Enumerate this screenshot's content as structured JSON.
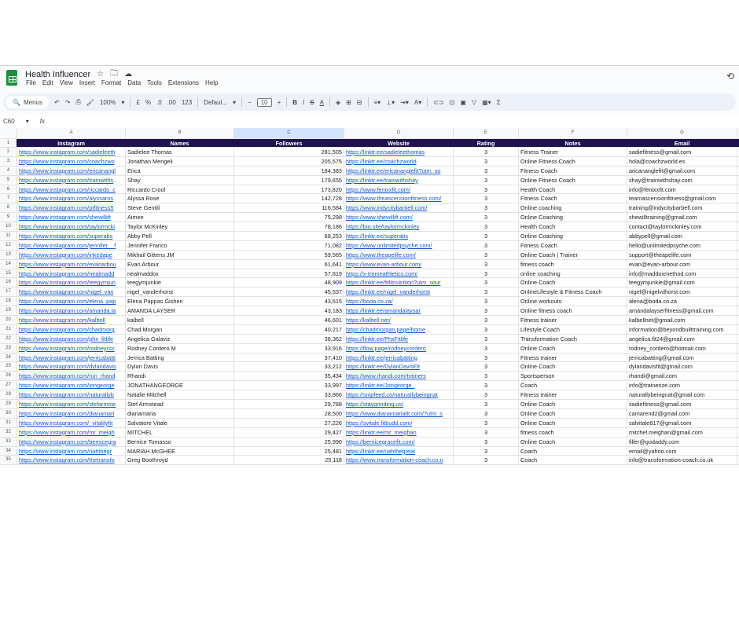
{
  "app": {
    "title": "Health Influencer",
    "menu": [
      "File",
      "Edit",
      "View",
      "Insert",
      "Format",
      "Data",
      "Tools",
      "Extensions",
      "Help"
    ]
  },
  "toolbar": {
    "search": "Menus",
    "zoom": "100%",
    "currency": "£",
    "percent": "%",
    "dec_less": ".0",
    "dec_more": ".00",
    "format_num": "123",
    "font": "Defaul...",
    "font_size": "10",
    "bold": "B",
    "italic": "I",
    "strike": "S",
    "text_color": "A",
    "sum": "Σ"
  },
  "formula_bar": {
    "cell_ref": "C60",
    "fx": "fx"
  },
  "columns": [
    "A",
    "B",
    "C",
    "D",
    "E",
    "F",
    "G"
  ],
  "headers": [
    "Instagram",
    "Names",
    "Followers",
    "Website",
    "Rating",
    "Notes",
    "Email"
  ],
  "rows": [
    [
      "https://www.instagram.com/sadieleeth",
      "Sadielee Thomas",
      "281,505",
      "https://linktr.ee/sadieleethomas",
      "3",
      "Fitness Trainer",
      "sadiefitness@gmail.com"
    ],
    [
      "https://www.instagram.com/coachzwo",
      "Jonathan Mengeli",
      "205,575",
      "https://linktr.ee/coachzworld",
      "3",
      "Online Fitness Coach",
      "hola@coachzworld.es"
    ],
    [
      "https://www.instagram.com/ericanangl",
      "Erica",
      "184,383",
      "https://linktr.ee/ericananglefit?utm_so",
      "3",
      "Fitness Coach",
      "aricananglefit@gmail.com"
    ],
    [
      "https://www.instagram.com/trainwiths",
      "Shay",
      "179,655",
      "https://linktr.ee/trainwithshay",
      "3",
      "Online Fitness Coach",
      "shay@trainwithshay.com"
    ],
    [
      "https://www.instagram.com/riccardo_c",
      "Riccardo Crool",
      "173,820",
      "https://www.fenixxfit.com/",
      "3",
      "Health Coach",
      "info@fenixxfit.com"
    ],
    [
      "https://www.instagram.com/alyssaros",
      "Alyssa Rose",
      "142,728",
      "https://www.theascensionfitness.com/",
      "3",
      "Fitness Coach",
      "teamascensionfitness@gmail.com"
    ],
    [
      "https://www.instagram.com/ptfitness5",
      "Steve Gentili",
      "116,584",
      "https://www.indycitybarbell.com/",
      "3",
      "Online coaching",
      "training@indycitybarbell.com"
    ],
    [
      "https://www.instagram.com/shewillift",
      "Aimee",
      "75,298",
      "https://www.shewillift.com/",
      "3",
      "Online Coaching",
      "shewilltraining@gmail.com"
    ],
    [
      "https://www.instagram.com/taylormcki",
      "Taylor McKinley",
      "78,186",
      "https://bio.site/taylormckinley",
      "3",
      "Health Coach",
      "contact@taylormckinley.com"
    ],
    [
      "https://www.instagram.com/superabs",
      "Abby Pell",
      "68,253",
      "https://linktr.ee/superabs",
      "3",
      "Online Coaching",
      "abbypell@gmail.com"
    ],
    [
      "https://www.instagram.com/jennifer__f",
      "Jennifer Franco",
      "71,082",
      "https://www.unlimitedpsyche.com/",
      "3",
      "Fitness Coach",
      "hello@unlimitedpsyche.com"
    ],
    [
      "https://www.instagram.com/inkedape",
      "Mikhail Gittens JM",
      "59,565",
      "https://www.theapelife.com/",
      "3",
      "Online Coach | Trainer",
      "support@theapelife.com"
    ],
    [
      "https://www.instagram.com/evanarbou",
      "Evan Arbour",
      "61,641",
      "https://www.evan-arbour.com/",
      "3",
      "fitness coach",
      "evan@evan-arbour.com"
    ],
    [
      "https://www.instagram.com/nealmadd",
      "nealmaddox",
      "57,819",
      "https://x-tremeathletics.com/",
      "3",
      "online coaching",
      "info@maddoxmethod.com"
    ],
    [
      "https://www.instagram.com/teegymjun",
      "teegymjunkie",
      "48,909",
      "https://linktr.ee/fitlitnutrition?utm_sour",
      "3",
      "Online Coach",
      "teegymjunkie@gmail.com"
    ],
    [
      "https://www.instagram.com/nigel_van",
      "nigel_vanderhorst",
      "45,537",
      "https://linktr.ee/nigel_vanderhorst",
      "3",
      "OnlineLifestyle & Fitness Coach",
      "nigel@nigelvdhorst.com"
    ],
    [
      "https://www.instagram.com/elena_pap",
      "Elena Pappas Gishen",
      "43,615",
      "https://boda.co.za/",
      "3",
      "Online workouts",
      "alena@boda.co.za"
    ],
    [
      "https://www.instagram.com/amanda.la",
      "AMANDA LAYSER",
      "43,183",
      "https://linktr.ee/amandalaysar",
      "3",
      "Online fitness coach",
      "amandalayserfitness@gmail.com"
    ],
    [
      "https://www.instagram.com/kalbell",
      "kalbell",
      "46,601",
      "https://kalbell.net/",
      "3",
      "Fitness trainer",
      "kalbellnet@gmail.com"
    ],
    [
      "https://www.instagram.com/chadmorg",
      "Chad Morgan",
      "40,217",
      "https://chadmorgan.page/home",
      "3",
      "Lifestyle Coach",
      "information@beyondbuilttraining.com"
    ],
    [
      "https://www.instagram.com/phx_fitlife",
      "Angelica Galaviz",
      "38,362",
      "https://linktr.ee/PhxFitlife",
      "3",
      "Transformation Coach",
      "angelica.fit24@gmail.com"
    ],
    [
      "https://www.instagram.com/rodneycor",
      "Rodney Cordero M",
      "33,916",
      "https://flow.page/rodneycordero",
      "3",
      "Online Coach",
      "rodney_cordero@hotmail.com"
    ],
    [
      "https://www.instagram.com/jerricabatti",
      "Jerrica Batting",
      "37,410",
      "https://linktr.ee/jerricabatting",
      "3",
      "Fitness trainer",
      "jerricabatting@gmail.com"
    ],
    [
      "https://www.instagram.com/dylandavis",
      "Dylan Davis",
      "33,212",
      "https://linktr.ee/DylanDavisFit",
      "3",
      "Online Coach",
      "dylandavisfit@gmail.com"
    ],
    [
      "https://www.instagram.com/run_rhand",
      "Rhandi",
      "35,434",
      "https://www.rhandi.com/trainers",
      "3",
      "Sportsperson",
      "rhandi@gmail.com"
    ],
    [
      "https://www.instagram.com/jongeorge",
      "JONATHANGEORGE",
      "33,997",
      "https://linktr.ee/Jongeorge_",
      "3",
      "Coach",
      "info@trainerize.com"
    ],
    [
      "https://www.instagram.com/naturallyb",
      "Natalie Mitchell",
      "33,866",
      "https://snipfeed.co/naturallybeingnat",
      "3",
      "Fitness trainer",
      "naturallybeingnat@gmail.com"
    ],
    [
      "https://www.instagram.com/stefarmste",
      "Stef Armstead",
      "29,788",
      "https://staygrinding.us/",
      "3",
      "Online Coach",
      "sadiefitness@gmail.com"
    ],
    [
      "https://www.instagram.com/dianamari",
      "dianamaria",
      "28,500",
      "https://www.dianamariafit.com/?utm_s",
      "3",
      "Online Coach",
      "camarend2@gmail.com"
    ],
    [
      "https://www.instagram.com/_vitalityfit",
      "Salvatore Vitale",
      "27,226",
      "https://svitale.fitbudd.com/",
      "3",
      "Online Coach",
      "salvitale817@gmail.com"
    ],
    [
      "https://www.instagram.com/mr_meigh",
      "MITCHEL",
      "29,427",
      "https://linktr.ee/mr_meighan",
      "3",
      "fitness coach",
      "mitchel.meighan@gmail.com"
    ],
    [
      "https://www.instagram.com/bernicegra",
      "Bernice Tomasso",
      "25,990",
      "https://bernicegracefit.com/",
      "3",
      "Online Coach",
      "filler@godaddy.com"
    ],
    [
      "https://www.instagram.com/riahthegr",
      "MARIAH McGHEE",
      "25,481",
      "https://linktr.ee/riahthegreat",
      "3",
      "Coach",
      "email@yahoo.com"
    ],
    [
      "https://www.instagram.com/thetransfo",
      "Greg Boothroyd",
      "25,118",
      "https://www.transformation-coach.co.u",
      "3",
      "Coach",
      "info@transformation-coach.co.uk"
    ]
  ],
  "colors": {
    "header_bg": "#20124d",
    "link": "#1155cc",
    "selected_col": "#d3e3fd"
  }
}
